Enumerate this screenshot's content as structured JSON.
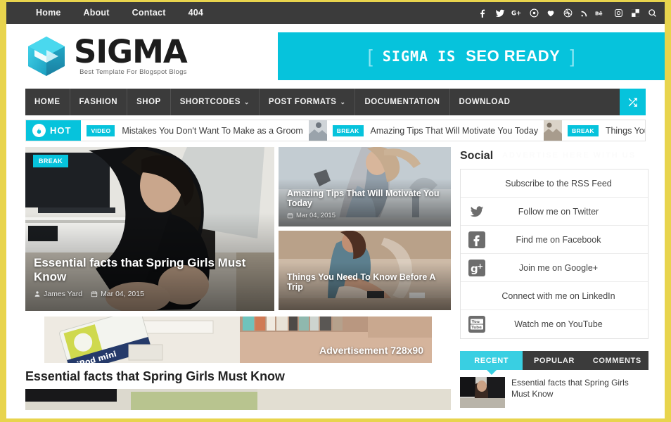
{
  "theme": {
    "accent": "#06c3dc",
    "accent_light": "#39cfe2",
    "frame": "#e8d44d",
    "dark": "#3b3b3b"
  },
  "topbar": {
    "nav": [
      {
        "label": "Home"
      },
      {
        "label": "About"
      },
      {
        "label": "Contact"
      },
      {
        "label": "404"
      }
    ],
    "social_icons": [
      "facebook-icon",
      "twitter-icon",
      "google-plus-icon",
      "pinterest-icon",
      "heart-icon",
      "dribbble-icon",
      "rss-icon",
      "behance-icon",
      "instagram-icon",
      "delicious-icon",
      "search-icon"
    ]
  },
  "header": {
    "logo_text": "SIGMA",
    "logo_tagline": "Best Template For Blogspot Blogs",
    "banner": {
      "bracket_left": "[",
      "text_bold": "SIGMA IS",
      "text_plain": "SEO READY",
      "bracket_right": "]"
    }
  },
  "mainnav": {
    "items": [
      {
        "label": "HOME",
        "caret": ""
      },
      {
        "label": "FASHION",
        "caret": ""
      },
      {
        "label": "SHOP",
        "caret": ""
      },
      {
        "label": "SHORTCODES",
        "caret": "⌄"
      },
      {
        "label": "POST FORMATS",
        "caret": "⌄"
      },
      {
        "label": "DOCUMENTATION",
        "caret": ""
      },
      {
        "label": "DOWNLOAD",
        "caret": ""
      }
    ],
    "shuffle_icon": "shuffle-icon"
  },
  "ticker": {
    "hot_label": "HOT",
    "hot_icon": "flame-icon",
    "items": [
      {
        "badge": "VIDEO",
        "title": "Mistakes You Don't Want To Make as a Groom"
      },
      {
        "badge": "BREAK",
        "title": "Amazing Tips That Will Motivate You Today"
      },
      {
        "badge": "BREAK",
        "title": "Things You Need To Know Before A Trip"
      }
    ]
  },
  "featured": {
    "big": {
      "badge": "BREAK",
      "title": "Essential facts that Spring Girls Must Know",
      "author": "James Yard",
      "date": "Mar 04, 2015"
    },
    "small": [
      {
        "title": "Amazing Tips That Will Motivate You Today",
        "date": "Mar 04, 2015"
      },
      {
        "title": "Things You Need To Know Before A Trip",
        "date": ""
      }
    ]
  },
  "advertisement": {
    "label": "Advertisement 728x90",
    "url": ""
  },
  "post": {
    "title": "Essential facts that Spring Girls Must Know"
  },
  "sidebar": {
    "social_widget": {
      "title": "Social",
      "ghost_text": "ADVERTISE HERE WITH US",
      "items": [
        {
          "icon": "rss-icon",
          "label": "Subscribe to the RSS Feed",
          "has_icon": false
        },
        {
          "icon": "twitter-icon",
          "label": "Follow me on Twitter",
          "has_icon": true
        },
        {
          "icon": "facebook-icon",
          "label": "Find me on Facebook",
          "has_icon": true
        },
        {
          "icon": "google-plus-icon",
          "label": "Join me on Google+",
          "has_icon": true
        },
        {
          "icon": "linkedin-icon",
          "label": "Connect with me on LinkedIn",
          "has_icon": false
        },
        {
          "icon": "youtube-icon",
          "label": "Watch me on YouTube",
          "has_icon": true
        }
      ]
    },
    "tabs": [
      {
        "label": "RECENT",
        "active": true
      },
      {
        "label": "POPULAR",
        "active": false
      },
      {
        "label": "COMMENTS",
        "active": false
      }
    ],
    "recent": [
      {
        "title": "Essential facts that Spring Girls Must Know"
      }
    ]
  }
}
